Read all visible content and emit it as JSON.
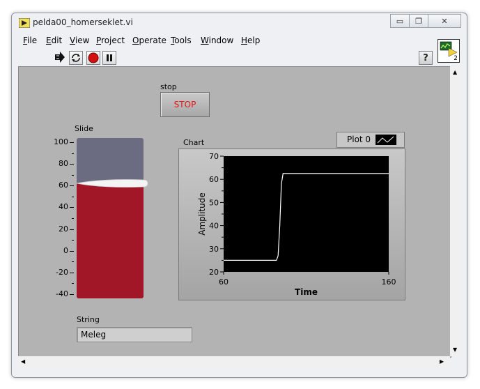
{
  "window": {
    "title": "pelda00_homerseklet.vi",
    "controls": {
      "minimize": "▭",
      "restore": "❐",
      "close": "✕"
    }
  },
  "menu": [
    {
      "label": "File",
      "underline": "F",
      "rest": "ile"
    },
    {
      "label": "Edit",
      "underline": "E",
      "rest": "dit"
    },
    {
      "label": "View",
      "underline": "V",
      "rest": "iew"
    },
    {
      "label": "Project",
      "underline": "P",
      "rest": "roject"
    },
    {
      "label": "Operate",
      "underline": "O",
      "rest": "perate"
    },
    {
      "label": "Tools",
      "underline": "T",
      "rest": "ools"
    },
    {
      "label": "Window",
      "underline": "W",
      "rest": "indow"
    },
    {
      "label": "Help",
      "underline": "H",
      "rest": "elp"
    }
  ],
  "toolbar": {
    "icons": [
      "run-arrow-icon",
      "run-continuously-icon",
      "abort-icon",
      "pause-icon"
    ],
    "help_label": "?",
    "vi_icon_number": "2"
  },
  "stop": {
    "label": "stop",
    "button_text": "STOP"
  },
  "slide": {
    "label": "Slide",
    "value": 62,
    "min": -40,
    "max": 100,
    "ticks": [
      "100",
      "80",
      "60",
      "40",
      "20",
      "0",
      "-20",
      "-40"
    ],
    "colors": {
      "empty": "#6b6b82",
      "fill": "#a21728"
    }
  },
  "chart": {
    "label": "Chart",
    "legend": "Plot 0",
    "chart_data": {
      "type": "line",
      "title": "",
      "xlabel": "Time",
      "ylabel": "Amplitude",
      "xlim": [
        60,
        160
      ],
      "ylim": [
        20,
        70
      ],
      "x_ticks": [
        "60",
        "160"
      ],
      "y_ticks": [
        "70",
        "60",
        "50",
        "40",
        "30",
        "20"
      ],
      "grid": false,
      "series": [
        {
          "name": "Plot 0",
          "color": "#ffffff",
          "x": [
            60,
            92,
            93,
            94,
            95,
            96,
            160
          ],
          "y": [
            25,
            25,
            27,
            40,
            58,
            62.5,
            62.5
          ]
        }
      ]
    }
  },
  "string": {
    "label": "String",
    "value": "Meleg"
  }
}
